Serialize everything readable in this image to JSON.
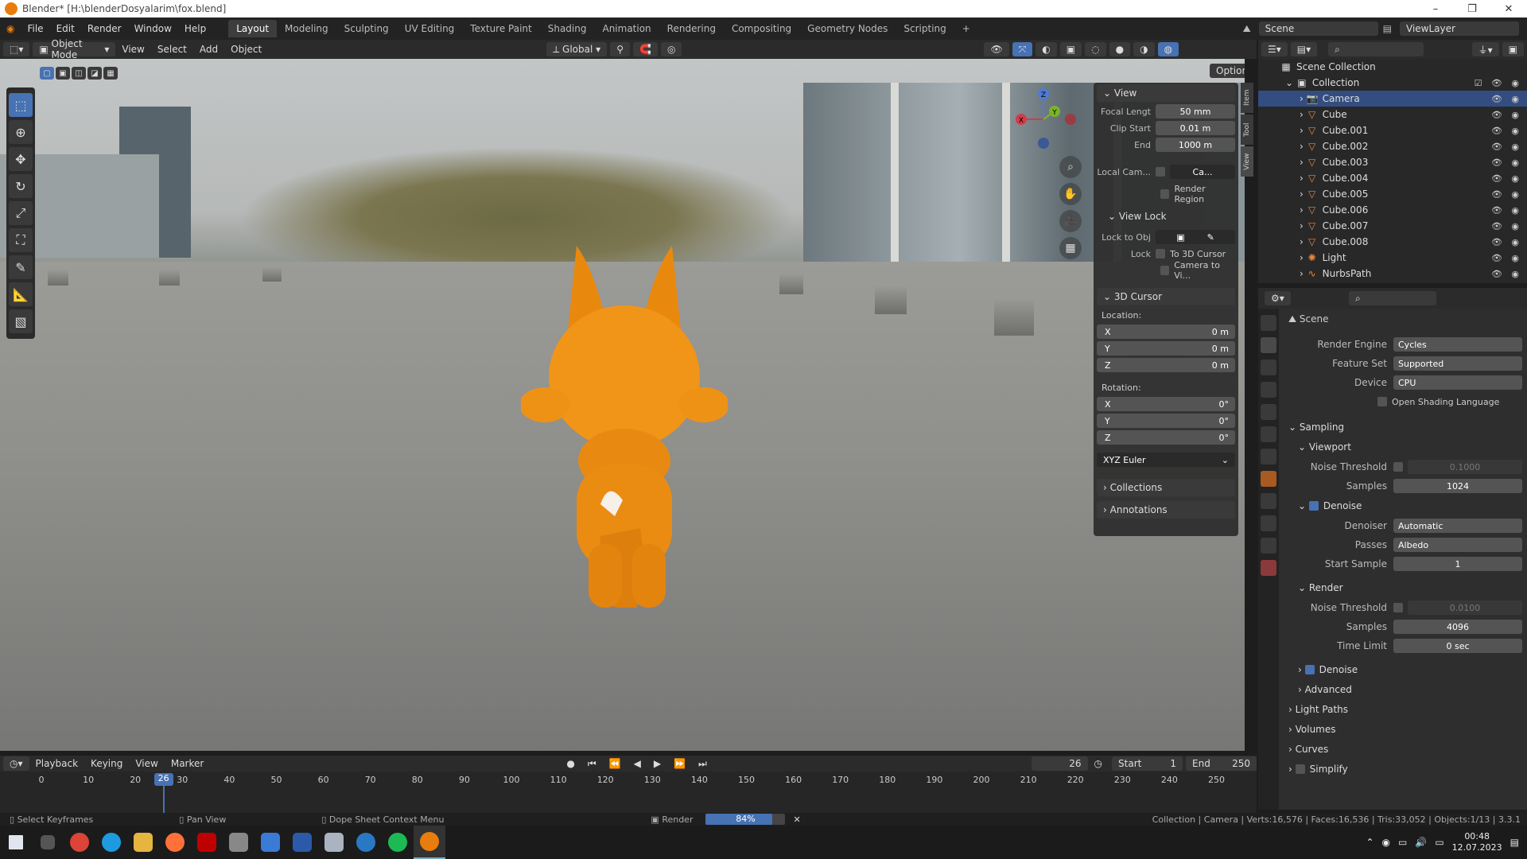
{
  "window": {
    "title": "Blender* [H:\\blenderDosyalarim\\fox.blend]"
  },
  "menu": [
    "File",
    "Edit",
    "Render",
    "Window",
    "Help"
  ],
  "workspaces": [
    "Layout",
    "Modeling",
    "Sculpting",
    "UV Editing",
    "Texture Paint",
    "Shading",
    "Animation",
    "Rendering",
    "Compositing",
    "Geometry Nodes",
    "Scripting"
  ],
  "scene": "Scene",
  "view_layer": "ViewLayer",
  "viewport_header": {
    "mode": "Object Mode",
    "menus": [
      "View",
      "Select",
      "Add",
      "Object"
    ],
    "orientation": "Global",
    "options": "Options"
  },
  "npanel": {
    "view_title": "View",
    "focal_label": "Focal Lengt",
    "focal": "50 mm",
    "clip_start_label": "Clip Start",
    "clip_start": "0.01 m",
    "clip_end_label": "End",
    "clip_end": "1000 m",
    "local_cam_label": "Local Cam...",
    "local_cam_value": "Ca...",
    "render_region": "Render Region",
    "view_lock_title": "View Lock",
    "lock_to_obj_label": "Lock to Obj",
    "lock_label": "Lock",
    "to_3d_cursor": "To 3D Cursor",
    "camera_to_view": "Camera to Vi...",
    "cursor_title": "3D Cursor",
    "location_label": "Location:",
    "rotation_label": "Rotation:",
    "loc": [
      {
        "axis": "X",
        "value": "0 m"
      },
      {
        "axis": "Y",
        "value": "0 m"
      },
      {
        "axis": "Z",
        "value": "0 m"
      }
    ],
    "rot": [
      {
        "axis": "X",
        "value": "0°"
      },
      {
        "axis": "Y",
        "value": "0°"
      },
      {
        "axis": "Z",
        "value": "0°"
      }
    ],
    "rot_mode": "XYZ Euler",
    "collections": "Collections",
    "annotations": "Annotations",
    "tabs": [
      "Item",
      "Tool",
      "View"
    ]
  },
  "gizmo": {
    "x": "X",
    "y": "Y",
    "z": "Z"
  },
  "outliner": {
    "root": "Scene Collection",
    "collection": "Collection",
    "items": [
      "Camera",
      "Cube",
      "Cube.001",
      "Cube.002",
      "Cube.003",
      "Cube.004",
      "Cube.005",
      "Cube.006",
      "Cube.007",
      "Cube.008",
      "Light",
      "NurbsPath"
    ]
  },
  "props": {
    "context": "Scene",
    "render_engine_label": "Render Engine",
    "render_engine": "Cycles",
    "feature_set_label": "Feature Set",
    "feature_set": "Supported",
    "device_label": "Device",
    "device": "CPU",
    "osl": "Open Shading Language",
    "sampling": "Sampling",
    "viewport": "Viewport",
    "noise_threshold_label": "Noise Threshold",
    "vp_noise": "0.1000",
    "samples_label": "Samples",
    "vp_samples": "1024",
    "denoise": "Denoise",
    "denoiser_label": "Denoiser",
    "denoiser": "Automatic",
    "passes_label": "Passes",
    "passes": "Albedo",
    "start_sample_label": "Start Sample",
    "start_sample": "1",
    "render": "Render",
    "r_noise": "0.0100",
    "r_samples": "4096",
    "time_limit_label": "Time Limit",
    "time_limit": "0 sec",
    "advanced": "Advanced",
    "light_paths": "Light Paths",
    "volumes": "Volumes",
    "curves": "Curves",
    "simplify": "Simplify"
  },
  "timeline": {
    "menus": [
      "Playback",
      "Keying",
      "View",
      "Marker"
    ],
    "current": "26",
    "start_label": "Start",
    "start": "1",
    "end_label": "End",
    "end": "250",
    "ticks": [
      "0",
      "10",
      "20",
      "30",
      "40",
      "50",
      "60",
      "70",
      "80",
      "90",
      "100",
      "110",
      "120",
      "130",
      "140",
      "150",
      "160",
      "170",
      "180",
      "190",
      "200",
      "210",
      "220",
      "230",
      "240",
      "250"
    ]
  },
  "status": {
    "left1": "Select Keyframes",
    "left2": "Pan View",
    "left3": "Dope Sheet Context Menu",
    "render_label": "Render",
    "progress": "84%",
    "progress_fraction": 0.84,
    "stats": "Collection | Camera | Verts:16,576 | Faces:16,536 | Tris:33,052 | Objects:1/13 | 3.3.1"
  },
  "taskbar": {
    "time": "00:48",
    "date": "12.07.2023"
  }
}
